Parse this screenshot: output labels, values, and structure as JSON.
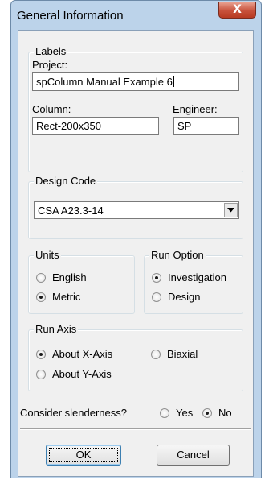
{
  "window": {
    "title": "General Information",
    "close_glyph": "X"
  },
  "labels_group": {
    "legend": "Labels",
    "project_label": "Project:",
    "project_value": "spColumn Manual Example 6",
    "column_label": "Column:",
    "column_value": "Rect-200x350",
    "engineer_label": "Engineer:",
    "engineer_value": "SP"
  },
  "design_code": {
    "legend": "Design Code",
    "selected": "CSA A23.3-14",
    "dropdown_icon": "chevron-down-icon"
  },
  "units": {
    "legend": "Units",
    "options": [
      "English",
      "Metric"
    ],
    "selected": "Metric"
  },
  "run_option": {
    "legend": "Run Option",
    "options": [
      "Investigation",
      "Design"
    ],
    "selected": "Investigation"
  },
  "run_axis": {
    "legend": "Run Axis",
    "options": [
      "About X-Axis",
      "Biaxial",
      "About Y-Axis"
    ],
    "selected": "About X-Axis"
  },
  "slenderness": {
    "label": "Consider slenderness?",
    "options": [
      "Yes",
      "No"
    ],
    "selected": "No"
  },
  "buttons": {
    "ok": "OK",
    "cancel": "Cancel"
  },
  "colors": {
    "frame": "#bcd3ea",
    "client": "#f0f0f0",
    "close_button": "#c8513b"
  }
}
